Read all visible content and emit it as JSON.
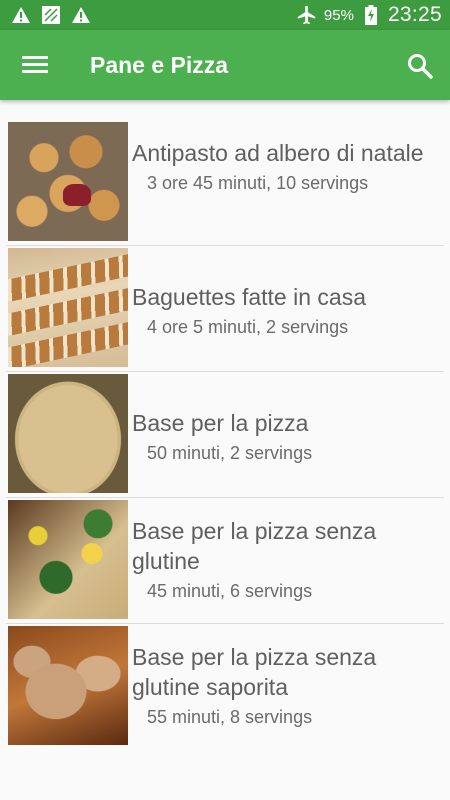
{
  "status_bar": {
    "left_icons": [
      "alert-icon",
      "sim-icon",
      "alert-icon"
    ],
    "right_icons": [
      "airplane-icon",
      "battery-charging-icon"
    ],
    "battery": "95%",
    "time": "23:25"
  },
  "toolbar": {
    "title": "Pane e Pizza",
    "menu_icon": "menu-icon",
    "search_icon": "search-icon",
    "color": "#4caf50"
  },
  "recipes": [
    {
      "name": "Antipasto ad albero di natale",
      "meta": "3 ore 45 minuti, 10 servings"
    },
    {
      "name": "Baguettes fatte in casa",
      "meta": "4 ore 5 minuti, 2 servings"
    },
    {
      "name": "Base per la pizza",
      "meta": "50 minuti, 2 servings"
    },
    {
      "name": "Base per la pizza senza glutine",
      "meta": "45 minuti, 6 servings"
    },
    {
      "name": "Base per la pizza senza glutine saporita",
      "meta": "55 minuti, 8 servings"
    }
  ]
}
